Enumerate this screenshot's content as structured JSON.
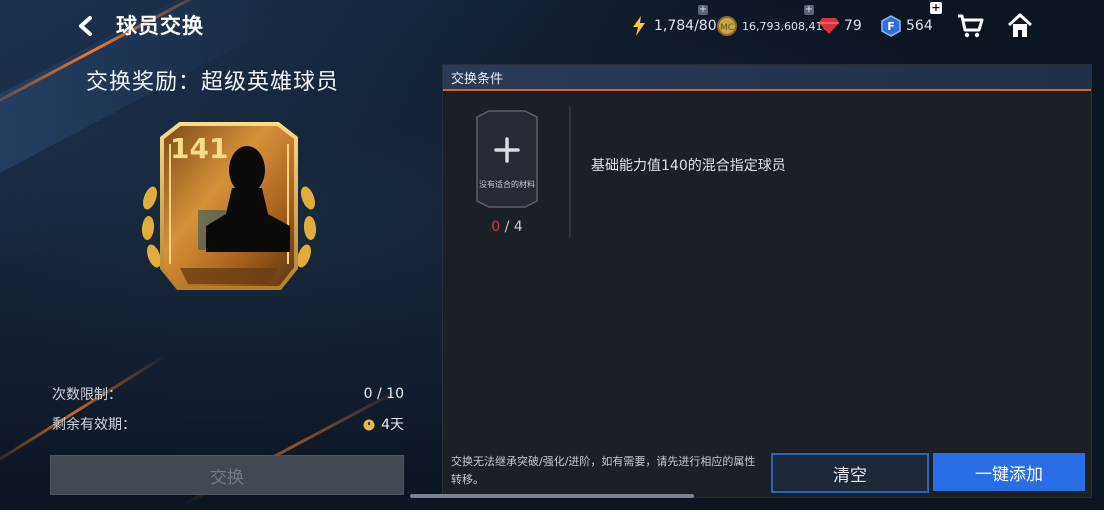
{
  "header": {
    "title": "球员交换",
    "resources": {
      "energy": "1,784/80",
      "coins": "16,793,608,416",
      "gems": "79",
      "fc_points": "564"
    }
  },
  "reward": {
    "title": "交换奖励：超级英雄球员",
    "card_rating": "141"
  },
  "stats": {
    "limit_label": "次数限制：",
    "limit_value": "0 / 10",
    "validity_label": "剩余有效期：",
    "validity_value": "4天"
  },
  "exchange_button": "交换",
  "conditions": {
    "header": "交换条件",
    "slot_placeholder": "没有适合的材料",
    "slot_current": "0",
    "slot_total": " / 4",
    "requirement": "基础能力值140的混合指定球员",
    "note": "交换无法继承突破/强化/进阶，如有需要，请先进行相应的属性转移。",
    "clear_button": "清空",
    "add_button": "一键添加"
  },
  "colors": {
    "accent_orange": "#d8652a",
    "primary_blue": "#2a6ee6",
    "danger_red": "#e0323c"
  }
}
